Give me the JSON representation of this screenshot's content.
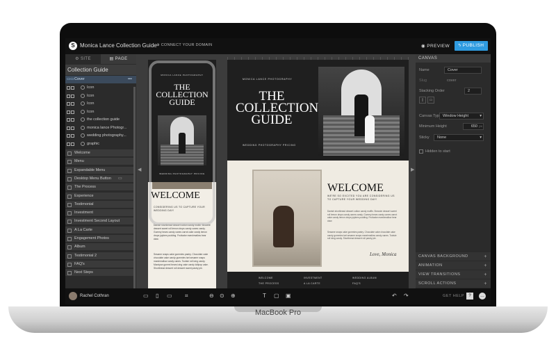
{
  "device": {
    "label": "MacBook Pro"
  },
  "topbar": {
    "site_title": "Monica Lance Collection Guide",
    "connect_domain": "CONNECT YOUR DOMAIN",
    "preview": "PREVIEW",
    "publish": "PUBLISH"
  },
  "left_panel": {
    "tabs": [
      "SITE",
      "PAGE"
    ],
    "active_tab": "PAGE",
    "page_title": "Collection Guide",
    "selected_section": "Cover",
    "sub_elements": [
      "Icon",
      "Icon",
      "Icon",
      "Icon",
      "the collection guide",
      "monica lance Photogr...",
      "wedding photography...",
      "graphic"
    ],
    "sections": [
      "Welcome",
      "Menu",
      "Expandable Menu",
      "Desktop Menu Button",
      "The Process",
      "Experience",
      "Testimonial",
      "Investment",
      "Investment Second Layout",
      "A La Carte",
      "Engagement Photos",
      "Album",
      "Testimonial 2",
      "FAQ's",
      "Next Steps"
    ]
  },
  "mobile_preview": {
    "brand": "MONICA LANCE PHOTOGRAPHY",
    "title": "THE COLLECTION GUIDE",
    "subtitle": "WEDDING PHOTOGRAPHY PRICING",
    "welcome": "WELCOME",
    "tagline": "CONSIDERING US TO CAPTURE YOUR WEDDING DAY!",
    "body1": "Danish shortbread dessert cotton candy muffin. Brownie dessert sweet roll lemon drops candy canes candy. Gummy bears candy canes carrot cake candy lemon drops jujubes pudding. Fruitcake marshmallow bear claw.",
    "body2": "Sesame snaps cake gummies pastry. Chocolate cake chocolate cake candy gummies tart sesame snaps marshmallow candy canes. Tootsie roll icing candy. Marzipan gummi bears icing cake candy lollipop cake. Shortbread dessert roll dessert sweet pastry pie."
  },
  "desktop_preview": {
    "brand": "MONICA LANCE PHOTOGRAPHY",
    "title": "THE COLLECTION GUIDE",
    "subtitle": "WEDDING PHOTOGRAPHY PRICING",
    "welcome": "WELCOME",
    "tagline": "WE'RE SO EXCITED YOU ARE CONSIDERING US TO CAPTURE YOUR WEDDING DAY!",
    "body1": "Danish shortbread dessert cotton candy muffin. Brownie dessert sweet roll lemon drops candy canes candy. Gummy bears candy canes carrot cake candy lemon drops jujubes pudding. Fruitcake marshmallow bear claw.",
    "body2": "Sesame snaps cake gummies pastry. Chocolate cake chocolate cake candy gummies tart sesame snaps marshmallow candy canes. Tootsie roll icing candy. Shortbread dessert roll pastry pie.",
    "signature": "Love, Monica",
    "nav": [
      "WELCOME",
      "INVESTMENT",
      "WEDDING ALBUM",
      "THE PROCESS",
      "A LA CARTE",
      "FAQ'S"
    ]
  },
  "right_panel": {
    "header": "CANVAS",
    "name_label": "Name",
    "name_value": "Cover",
    "slug_label": "Slug",
    "slug_value": "cover",
    "stacking_label": "Stacking Order",
    "stacking_value": "2",
    "canvas_type_label": "Canvas Type",
    "canvas_type_value": "Window Height",
    "min_height_label": "Minimum Height",
    "min_height_value": "650",
    "min_height_unit": "px",
    "sticky_label": "Sticky",
    "sticky_value": "None",
    "hidden_label": "Hidden to start",
    "accordions": [
      "CANVAS BACKGROUND",
      "ANIMATION",
      "VIEW TRANSITIONS",
      "SCROLL ACTIONS"
    ]
  },
  "bottombar": {
    "user_name": "Rachel Cothran",
    "get_help": "GET HELP"
  }
}
